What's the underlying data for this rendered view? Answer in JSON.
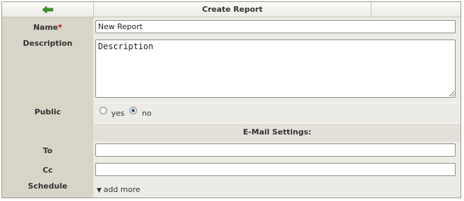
{
  "header": {
    "title": "Create Report",
    "back_icon": "back-arrow-icon"
  },
  "form": {
    "name": {
      "label": "Name",
      "required_mark": "*",
      "value": "New Report"
    },
    "description": {
      "label": "Description",
      "value": "Description"
    },
    "public": {
      "label": "Public",
      "options": [
        {
          "label": "yes",
          "checked": false
        },
        {
          "label": "no",
          "checked": true
        }
      ]
    }
  },
  "email": {
    "section_title": "E-Mail Settings:",
    "to": {
      "label": "To",
      "value": ""
    },
    "cc": {
      "label": "Cc",
      "value": ""
    },
    "schedule": {
      "label": "Schedule",
      "add_more": "add more",
      "icon": "chevron-down-icon"
    }
  },
  "colors": {
    "label_bg": "#d7d4c8",
    "field_bg": "#ecebe6",
    "required": "#c00000",
    "back_arrow": "#3c9a28"
  }
}
